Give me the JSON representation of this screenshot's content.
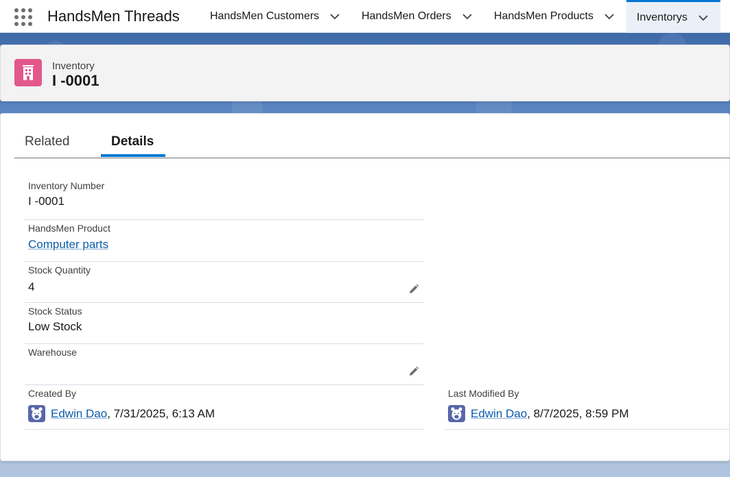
{
  "app": {
    "name": "HandsMen Threads"
  },
  "nav": {
    "items": [
      {
        "label": "HandsMen Customers"
      },
      {
        "label": "HandsMen Orders"
      },
      {
        "label": "HandsMen Products"
      },
      {
        "label": "Inventorys"
      }
    ]
  },
  "header": {
    "object_label": "Inventory",
    "record_title": "I -0001"
  },
  "tabs": {
    "related": "Related",
    "details": "Details"
  },
  "fields": {
    "inventory_number": {
      "label": "Inventory Number",
      "value": "I -0001"
    },
    "product": {
      "label": "HandsMen Product",
      "value": "Computer parts"
    },
    "stock_quantity": {
      "label": "Stock Quantity",
      "value": "4"
    },
    "stock_status": {
      "label": "Stock Status",
      "value": "Low Stock"
    },
    "warehouse": {
      "label": "Warehouse",
      "value": ""
    },
    "created_by": {
      "label": "Created By",
      "user": "Edwin Dao",
      "date": ", 7/31/2025, 6:13 AM"
    },
    "last_modified_by": {
      "label": "Last Modified By",
      "user": "Edwin Dao",
      "date": ", 8/7/2025, 8:59 PM"
    }
  },
  "colors": {
    "accent": "#0176d3",
    "record_icon": "#e3588a",
    "link": "#0b5cab",
    "banner": "#4f7cba"
  },
  "icons": {
    "launcher": "app-launcher-icon",
    "record": "building-icon",
    "edit": "pencil-icon",
    "avatar": "bear-avatar-icon",
    "chevron": "chevron-down-icon"
  }
}
